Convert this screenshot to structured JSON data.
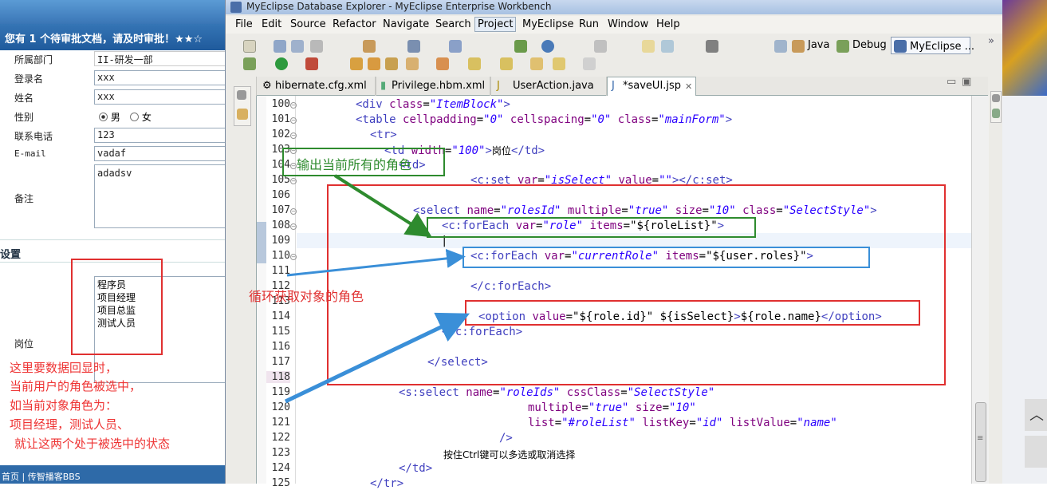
{
  "left_form": {
    "banner": "您有 1 个待审批文档，请及时审批！★★☆",
    "dept_label": "所属部门",
    "dept_value": "II-研发一部",
    "login_label": "登录名",
    "login_value": "xxx",
    "name_label": "姓名",
    "name_value": "xxx",
    "gender_label": "性别",
    "gender_male": "男",
    "gender_female": "女",
    "phone_label": "联系电话",
    "phone_value": "123",
    "email_label": "E-mail",
    "email_value": "vadaf",
    "remark_label": "备注",
    "remark_value": "adadsv",
    "section_title": "设置",
    "post_label": "岗位",
    "roles": [
      "程序员",
      "项目经理",
      "项目总监",
      "测试人员"
    ],
    "footer": "首页 | 传智播客BBS"
  },
  "notes": {
    "left_note": [
      "这里要数据回显时，",
      "当前用户的角色被选中，",
      "如当前对象角色为：",
      "项目经理，测试人员、",
      "就让这两个处于被选中的状态"
    ],
    "output_all_roles": "输出当前所有的角色",
    "loop_roles": "循环获取对象的角色"
  },
  "window": {
    "title": "MyEclipse Database Explorer - MyEclipse Enterprise Workbench",
    "menus": [
      "File",
      "Edit",
      "Source",
      "Refactor",
      "Navigate",
      "Search",
      "Project",
      "MyEclipse",
      "Run",
      "Window",
      "Help"
    ],
    "perspectives": [
      "Java",
      "Debug",
      "MyEclipse ..."
    ],
    "tabs": [
      "hibernate.cfg.xml",
      "Privilege.hbm.xml",
      "UserAction.java",
      "*saveUI.jsp"
    ]
  },
  "code": {
    "line_numbers": [
      "100",
      "101",
      "102",
      "103",
      "104",
      "105",
      "106",
      "107",
      "108",
      "109",
      "110",
      "111",
      "112",
      "113",
      "114",
      "115",
      "116",
      "117",
      "118",
      "119",
      "120",
      "121",
      "122",
      "123",
      "124",
      "125"
    ],
    "ctrl_hint": "按住Ctrl键可以多选或取消选择",
    "post_text": "岗位"
  },
  "colors": {
    "green_box": "#2e8b2e",
    "red_box": "#e03030",
    "blue_box": "#3a8fd8"
  }
}
